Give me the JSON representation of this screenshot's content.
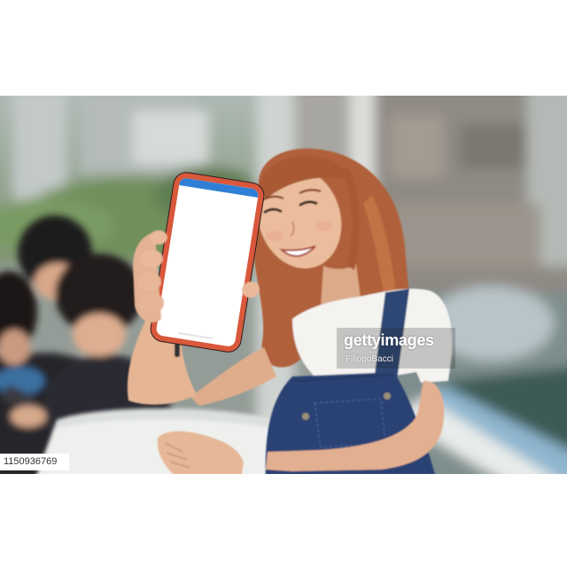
{
  "image_id": "1150936769",
  "watermark": {
    "brand": "gettyimages",
    "credit": "FilippoBacci"
  },
  "colors": {
    "page_background": "#ffffff",
    "phone_case": "#d9583c",
    "phone_screen": "#ffffff",
    "screen_status_bar": "#2f7fd6"
  }
}
